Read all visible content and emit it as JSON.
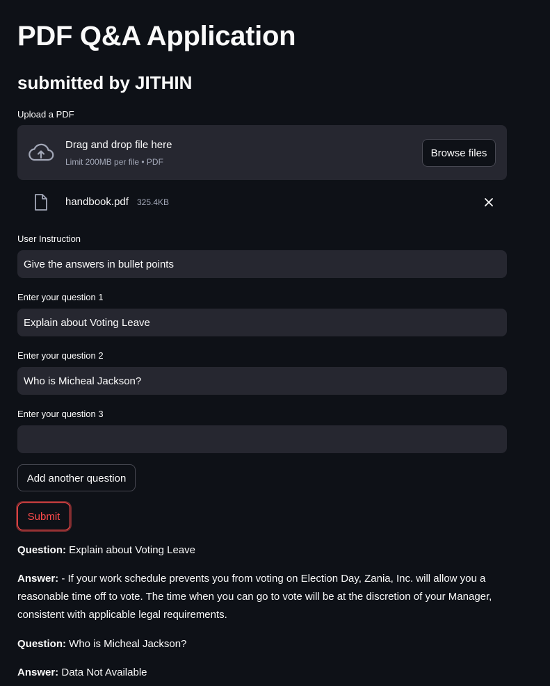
{
  "page": {
    "title": "PDF Q&A Application",
    "subtitle": "submitted by JITHIN"
  },
  "upload": {
    "label": "Upload a PDF",
    "drop_text": "Drag and drop file here",
    "limit_text": "Limit 200MB per file • PDF",
    "browse_label": "Browse files",
    "file": {
      "name": "handbook.pdf",
      "size": "325.4KB"
    }
  },
  "form": {
    "instruction_label": "User Instruction",
    "instruction_value": "Give the answers in bullet points",
    "questions": [
      {
        "label": "Enter your question 1",
        "value": "Explain about Voting Leave"
      },
      {
        "label": "Enter your question 2",
        "value": "Who is Micheal Jackson?"
      },
      {
        "label": "Enter your question 3",
        "value": ""
      }
    ],
    "add_question_label": "Add another question",
    "submit_label": "Submit"
  },
  "results": [
    {
      "question_prefix": "Question:",
      "question": " Explain about Voting Leave",
      "answer_prefix": "Answer:",
      "answer": " - If your work schedule prevents you from voting on Election Day, Zania, Inc. will allow you a reasonable time off to vote. The time when you can go to vote will be at the discretion of your Manager, consistent with applicable legal requirements."
    },
    {
      "question_prefix": "Question:",
      "question": " Who is Micheal Jackson?",
      "answer_prefix": "Answer:",
      "answer": " Data Not Available"
    }
  ],
  "colors": {
    "background": "#0e1117",
    "input_bg": "#262730",
    "text": "#fafafa",
    "muted": "#a3a8b8",
    "accent": "#ff4b4b"
  },
  "icons": {
    "upload": "cloud-upload-icon",
    "file": "file-icon",
    "close": "close-icon"
  }
}
